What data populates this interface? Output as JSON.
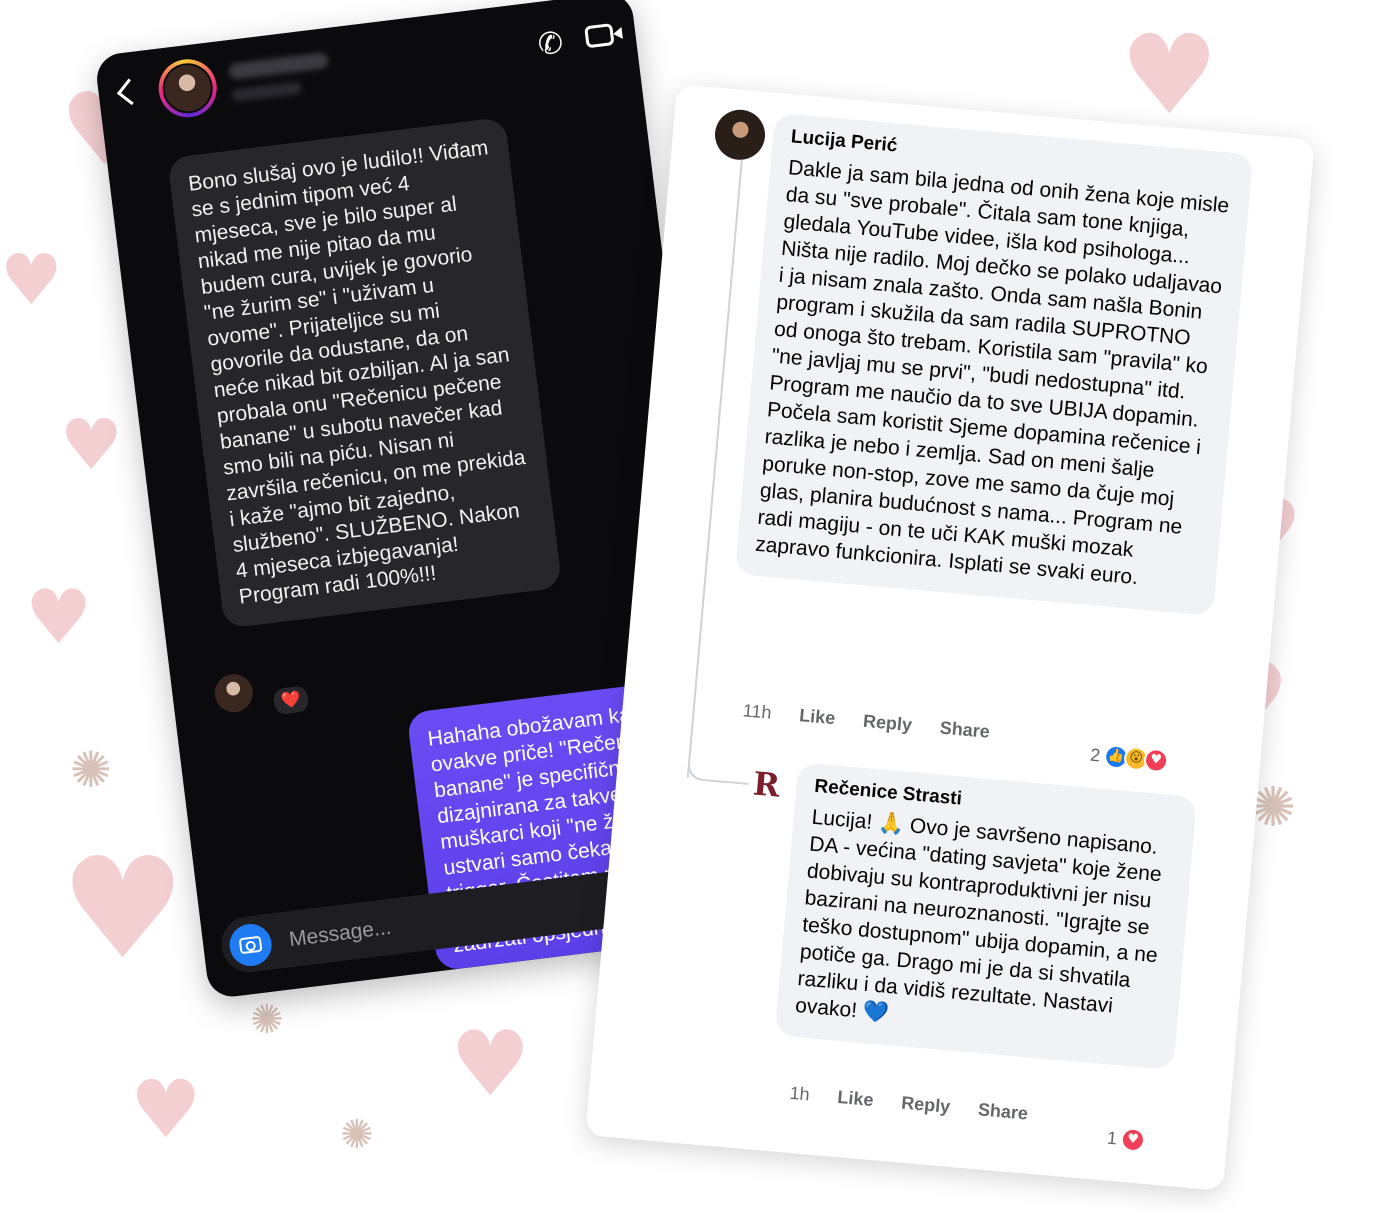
{
  "dm": {
    "message_in": "Bono slušaj ovo je ludilo!! Viđam se s jednim tipom već 4 mjeseca, sve je bilo super al nikad me nije pitao da mu budem cura, uvijek je govorio \"ne žurim se\" i \"uživam u ovome\". Prijateljice su mi govorile da odustane, da on neće nikad bit ozbiljan. Al ja san probala onu \"Rečenicu pečene banane\" u subotu navečer kad smo bili na piću. Nisan ni završila rečenicu, on me prekida i kaže \"ajmo bit zajedno, službeno\". SLUŽBENO. Nakon 4 mjeseca izbjegavanja! Program radi 100%!!!",
    "reaction": "❤️",
    "message_out": "Hahaha obožavam kad čujem ovakve priče! \"Rečenica pečene banane\" je specifično dizajnirana za takve situacije - muškarci koji \"ne žure\" ali ustvari samo čekaju pravi trigger. Čestitam na novoj vezi! Ako trebaš pomoć kako ga zadržati opsjednutim",
    "input_placeholder": "Message...",
    "icons": {
      "back": "chevron-left-icon",
      "phone": "phone-icon",
      "video": "video-camera-icon",
      "camera": "camera-icon"
    },
    "colors": {
      "background": "#0b0b0e",
      "incoming_bubble": "#26262b",
      "outgoing_bubble": "#6a4cf5",
      "camera_button": "#1f7bf2"
    }
  },
  "fb": {
    "comment1": {
      "author": "Lucija Perić",
      "text": "Dakle ja sam bila jedna od onih žena koje misle da su \"sve probale\". Čitala sam tone knjiga, gledala YouTube videe, išla kod psihologa... Ništa nije radilo. Moj dečko se polako udaljavao i ja nisam znala zašto. Onda sam našla Bonin program i skužila da sam radila SUPROTNO od onoga što trebam. Koristila sam \"pravila\" ko \"ne javljaj mu se prvi\", \"budi nedostupna\" itd. Program me naučio da to sve UBIJA dopamin. Počela sam koristit Sjeme dopamina rečenice i razlika je nebo i zemlja. Sad on meni šalje poruke non-stop, zove me samo da čuje moj glas, planira budućnost s nama... Program ne radi magiju - on te uči KAK muški mozak zapravo funkcionira. Isplati se svaki euro.",
      "time": "11h",
      "like": "Like",
      "reply": "Reply",
      "share": "Share",
      "reaction_count": "2"
    },
    "comment2": {
      "author": "Rečenice Strasti",
      "logo_letter": "R",
      "text": "Lucija! 🙏 Ovo je savršeno napisano. DA - većina \"dating savjeta\" koje žene dobivaju su kontraproduktivni jer nisu bazirani na neuroznanosti. \"Igrajte se teško dostupnom\" ubija dopamin, a ne potiče ga. Drago mi je da si shvatila razliku i da vidiš rezultate. Nastavi ovako! 💙",
      "time": "1h",
      "like": "Like",
      "reply": "Reply",
      "share": "Share",
      "reaction_count": "1"
    },
    "reaction_icons": {
      "like": "👍",
      "wow": "😮",
      "love": "♥"
    },
    "colors": {
      "bubble": "#f0f2f5",
      "like": "#1877f2",
      "love": "#f33e58",
      "wow": "#f7b928",
      "logo": "#7a1f2b"
    }
  },
  "decor": {
    "heart_glyph": "♥",
    "sparkle_glyph": "✺",
    "heart_color": "#f4cfd2"
  }
}
